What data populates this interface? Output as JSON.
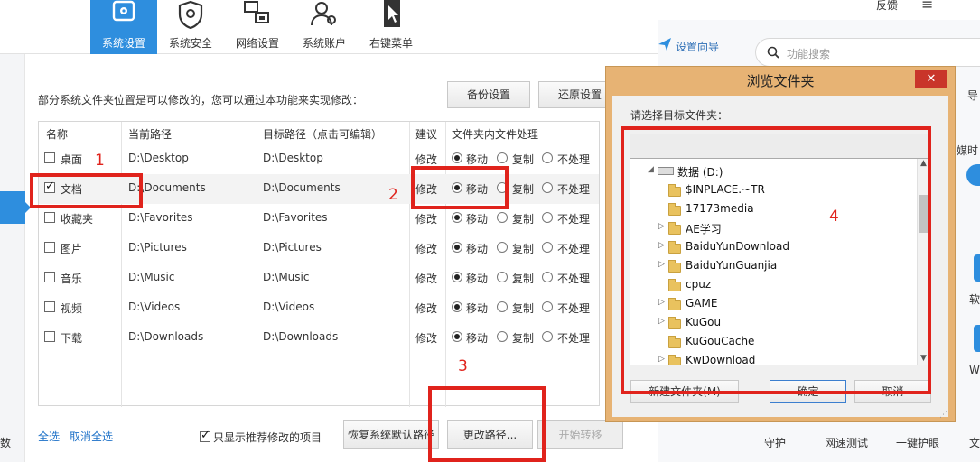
{
  "nav": {
    "tabs": [
      {
        "label": "系统设置",
        "icon": "gear-icon"
      },
      {
        "label": "系统安全",
        "icon": "shield-gear-icon"
      },
      {
        "label": "网络设置",
        "icon": "network-icon"
      },
      {
        "label": "系统账户",
        "icon": "users-icon"
      },
      {
        "label": "右键菜单",
        "icon": "cursor-menu-icon"
      }
    ]
  },
  "left_strip_text": "数",
  "description": "部分系统文件夹位置是可以修改的，您可以通过本功能来实现修改：",
  "buttons": {
    "backup": "备份设置",
    "restore": "还原设置",
    "restore_default": "恢复系统默认路径",
    "change_path": "更改路径...",
    "start_transfer": "开始转移"
  },
  "table": {
    "headers": [
      "名称",
      "当前路径",
      "目标路径（点击可编辑）",
      "建议",
      "文件夹内文件处理"
    ],
    "option_labels": [
      "移动",
      "复制",
      "不处理"
    ],
    "rows": [
      {
        "name": "桌面",
        "current": "D:\\Desktop",
        "target": "D:\\Desktop",
        "advice": "修改",
        "checked": false
      },
      {
        "name": "文档",
        "current": "D:\\Documents",
        "target": "D:\\Documents",
        "advice": "修改",
        "checked": true
      },
      {
        "name": "收藏夹",
        "current": "D:\\Favorites",
        "target": "D:\\Favorites",
        "advice": "修改",
        "checked": false
      },
      {
        "name": "图片",
        "current": "D:\\Pictures",
        "target": "D:\\Pictures",
        "advice": "修改",
        "checked": false
      },
      {
        "name": "音乐",
        "current": "D:\\Music",
        "target": "D:\\Music",
        "advice": "修改",
        "checked": false
      },
      {
        "name": "视频",
        "current": "D:\\Videos",
        "target": "D:\\Videos",
        "advice": "修改",
        "checked": false
      },
      {
        "name": "下载",
        "current": "D:\\Downloads",
        "target": "D:\\Downloads",
        "advice": "修改",
        "checked": false
      }
    ]
  },
  "footer": {
    "select_all": "全选",
    "deselect_all": "取消全选",
    "only_recommended": "只显示推荐修改的项目"
  },
  "annotations": [
    "1",
    "2",
    "3",
    "4"
  ],
  "right": {
    "feedback": "反馈",
    "menu_icon": "≡",
    "wizard": "设置向导",
    "search_placeholder": "功能搜索",
    "edge_a": "导",
    "edge_b": "媒时",
    "edge_c": "软",
    "edge_d": "W",
    "bottom_items": [
      "守护",
      "网速测试",
      "一键护眼",
      "文"
    ]
  },
  "dialog": {
    "title": "浏览文件夹",
    "close": "✕",
    "prompt": "请选择目标文件夹：",
    "tree": [
      {
        "label": "数据 (D:)",
        "drive": true
      },
      {
        "label": "$INPLACE.~TR"
      },
      {
        "label": "17173media"
      },
      {
        "label": "AE学习"
      },
      {
        "label": "BaiduYunDownload"
      },
      {
        "label": "BaiduYunGuanjia"
      },
      {
        "label": "cpuz"
      },
      {
        "label": "GAME"
      },
      {
        "label": "KuGou"
      },
      {
        "label": "KuGouCache"
      },
      {
        "label": "KwDownload"
      }
    ],
    "new_folder": "新建文件夹(M)",
    "ok": "确定",
    "cancel": "取消"
  }
}
